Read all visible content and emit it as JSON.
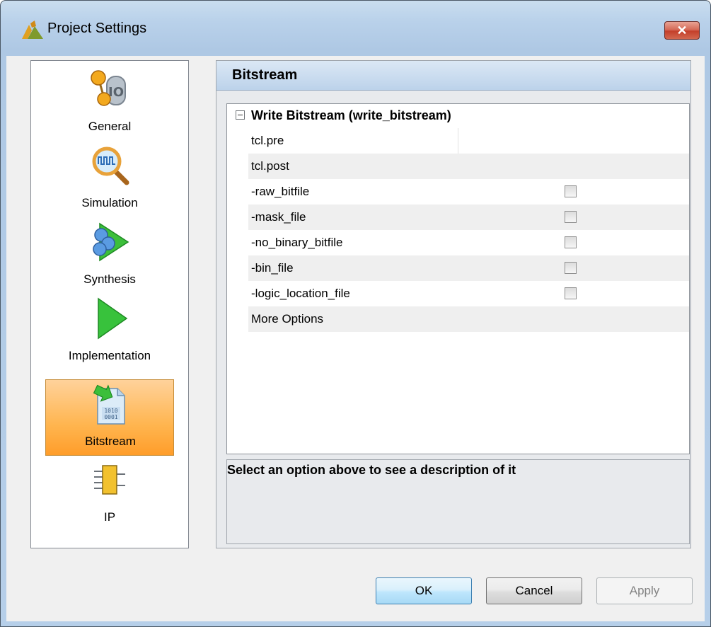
{
  "window": {
    "title": "Project Settings",
    "close_label": "✕"
  },
  "nav": {
    "items": [
      {
        "label": "General",
        "icon": "gear-balls-icon",
        "selected": false
      },
      {
        "label": "Simulation",
        "icon": "magnifier-waveform-icon",
        "selected": false
      },
      {
        "label": "Synthesis",
        "icon": "synthesis-arrow-icon",
        "selected": false
      },
      {
        "label": "Implementation",
        "icon": "play-triangle-icon",
        "selected": false
      },
      {
        "label": "Bitstream",
        "icon": "bitstream-file-icon",
        "selected": true,
        "file_text": "1010\n0001"
      },
      {
        "label": "IP",
        "icon": "ip-chip-icon",
        "selected": false
      }
    ]
  },
  "panel": {
    "title": "Bitstream",
    "group": {
      "label": "Write Bitstream (write_bitstream)",
      "expanded": true
    },
    "rows": [
      {
        "label": "tcl.pre",
        "type": "text",
        "value": ""
      },
      {
        "label": "tcl.post",
        "type": "text",
        "value": ""
      },
      {
        "label": "-raw_bitfile",
        "type": "checkbox",
        "checked": false
      },
      {
        "label": "-mask_file",
        "type": "checkbox",
        "checked": false
      },
      {
        "label": "-no_binary_bitfile",
        "type": "checkbox",
        "checked": false
      },
      {
        "label": "-bin_file",
        "type": "checkbox",
        "checked": false
      },
      {
        "label": "-logic_location_file",
        "type": "checkbox",
        "checked": false
      },
      {
        "label": "More Options",
        "type": "text",
        "value": ""
      }
    ],
    "description": "Select an option above to see a description of it"
  },
  "buttons": {
    "ok": "OK",
    "cancel": "Cancel",
    "apply": "Apply"
  },
  "colors": {
    "selected_nav": "#ffb54f",
    "title_gradient": "#b9d1ea",
    "close_button": "#c4402b"
  }
}
